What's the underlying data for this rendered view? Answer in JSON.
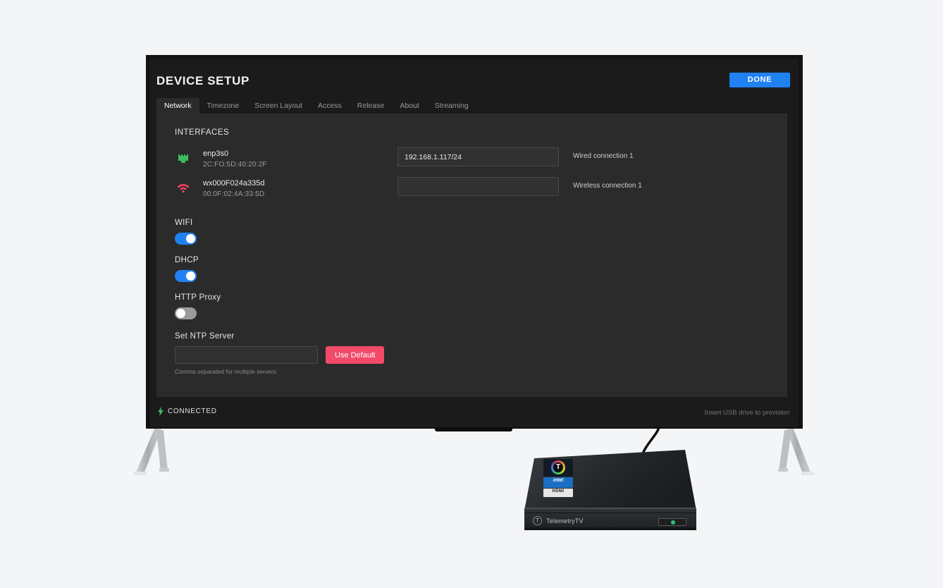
{
  "header": {
    "title": "DEVICE SETUP",
    "done_label": "DONE"
  },
  "tabs": [
    {
      "label": "Network",
      "active": true
    },
    {
      "label": "Timezone",
      "active": false
    },
    {
      "label": "Screen Layout",
      "active": false
    },
    {
      "label": "Access",
      "active": false
    },
    {
      "label": "Release",
      "active": false
    },
    {
      "label": "About",
      "active": false
    },
    {
      "label": "Streaming",
      "active": false
    }
  ],
  "interfaces": {
    "section_title": "INTERFACES",
    "rows": [
      {
        "icon": "ethernet-icon",
        "icon_color": "#3dbb5e",
        "name": "enp3s0",
        "mac": "2C:FO:5D:40:20:2F",
        "address": "192.168.1.117/24",
        "placeholder": "",
        "connection": "Wired connection 1"
      },
      {
        "icon": "wifi-icon",
        "icon_color": "#e8415f",
        "name": "wx000F024a335d",
        "mac": "00:0F:02:4A:33:5D",
        "address": "",
        "placeholder": "",
        "connection": "Wireless connection 1"
      }
    ]
  },
  "toggles": [
    {
      "label": "WIFI",
      "on": true
    },
    {
      "label": "DHCP",
      "on": true
    },
    {
      "label": "HTTP Proxy",
      "on": false
    }
  ],
  "ntp": {
    "label": "Set NTP Server",
    "value": "",
    "placeholder": "",
    "button_label": "Use Default",
    "hint": "Comma separated for multiple servers"
  },
  "status": {
    "icon": "lightning-bolt-icon",
    "text": "CONNECTED",
    "right_text": "Insert USB drive to provision"
  },
  "device": {
    "brand": "TelemetryTV",
    "brand_mark": "T",
    "stickers": [
      {
        "name": "telemetrytv-sticker",
        "text": "T"
      },
      {
        "name": "intel-sticker",
        "text": "intel"
      },
      {
        "name": "hdmi-sticker",
        "text": "HDMI"
      }
    ]
  },
  "colors": {
    "accent_blue": "#2081f2",
    "accent_pink": "#f24a68",
    "status_green": "#3dbb5e",
    "panel_bg": "#2b2b2b",
    "screen_bg": "#1b1b1b",
    "page_bg": "#f4f5f7"
  }
}
